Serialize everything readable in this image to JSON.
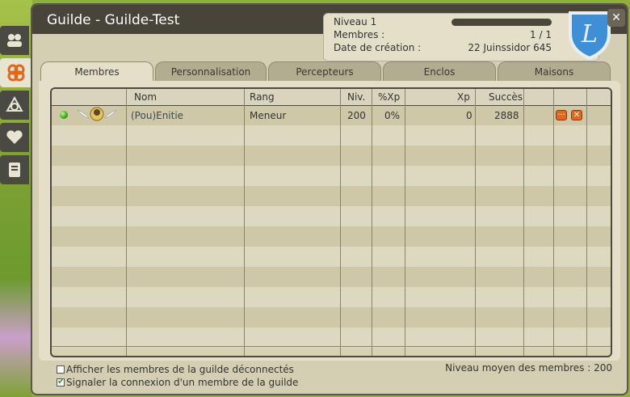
{
  "window": {
    "title": "Guilde - Guilde-Test",
    "close_label": "✕"
  },
  "info": {
    "level_label": "Niveau 1",
    "level_progress": 0.0,
    "members_label": "Membres :",
    "members_value": "1 / 1",
    "created_label": "Date de création :",
    "created_value": "22 Juinssidor 645"
  },
  "emblem": {
    "letter": "L",
    "icon": "guild-emblem-shield"
  },
  "side_tabs": [
    {
      "icon": "friends-icon"
    },
    {
      "icon": "guild-icon",
      "active": true
    },
    {
      "icon": "alliance-icon"
    },
    {
      "icon": "spouse-heart-icon"
    },
    {
      "icon": "directory-book-icon"
    }
  ],
  "tabs": [
    {
      "label": "Membres",
      "active": true
    },
    {
      "label": "Personnalisation"
    },
    {
      "label": "Percepteurs"
    },
    {
      "label": "Enclos"
    },
    {
      "label": "Maisons"
    }
  ],
  "table": {
    "headers": {
      "nom": "Nom",
      "rang": "Rang",
      "niv": "Niv.",
      "pxp": "%Xp",
      "xp": "Xp",
      "succes": "Succès"
    },
    "rows": [
      {
        "name": "(Pou)Enitie",
        "rank": "Meneur",
        "level": "200",
        "pxp": "0%",
        "xp": "0",
        "success": "2888",
        "online": true
      }
    ]
  },
  "options": {
    "show_offline": "Afficher les membres de la guilde déconnectés",
    "show_offline_checked": false,
    "notify_login": "Signaler la connexion d'un membre de la guilde",
    "notify_login_checked": true
  },
  "average": {
    "text": "Niveau moyen des membres : 200"
  },
  "colors": {
    "accent": "#e0681c",
    "online": "#3aa41c",
    "title_bar": "#48443a"
  }
}
